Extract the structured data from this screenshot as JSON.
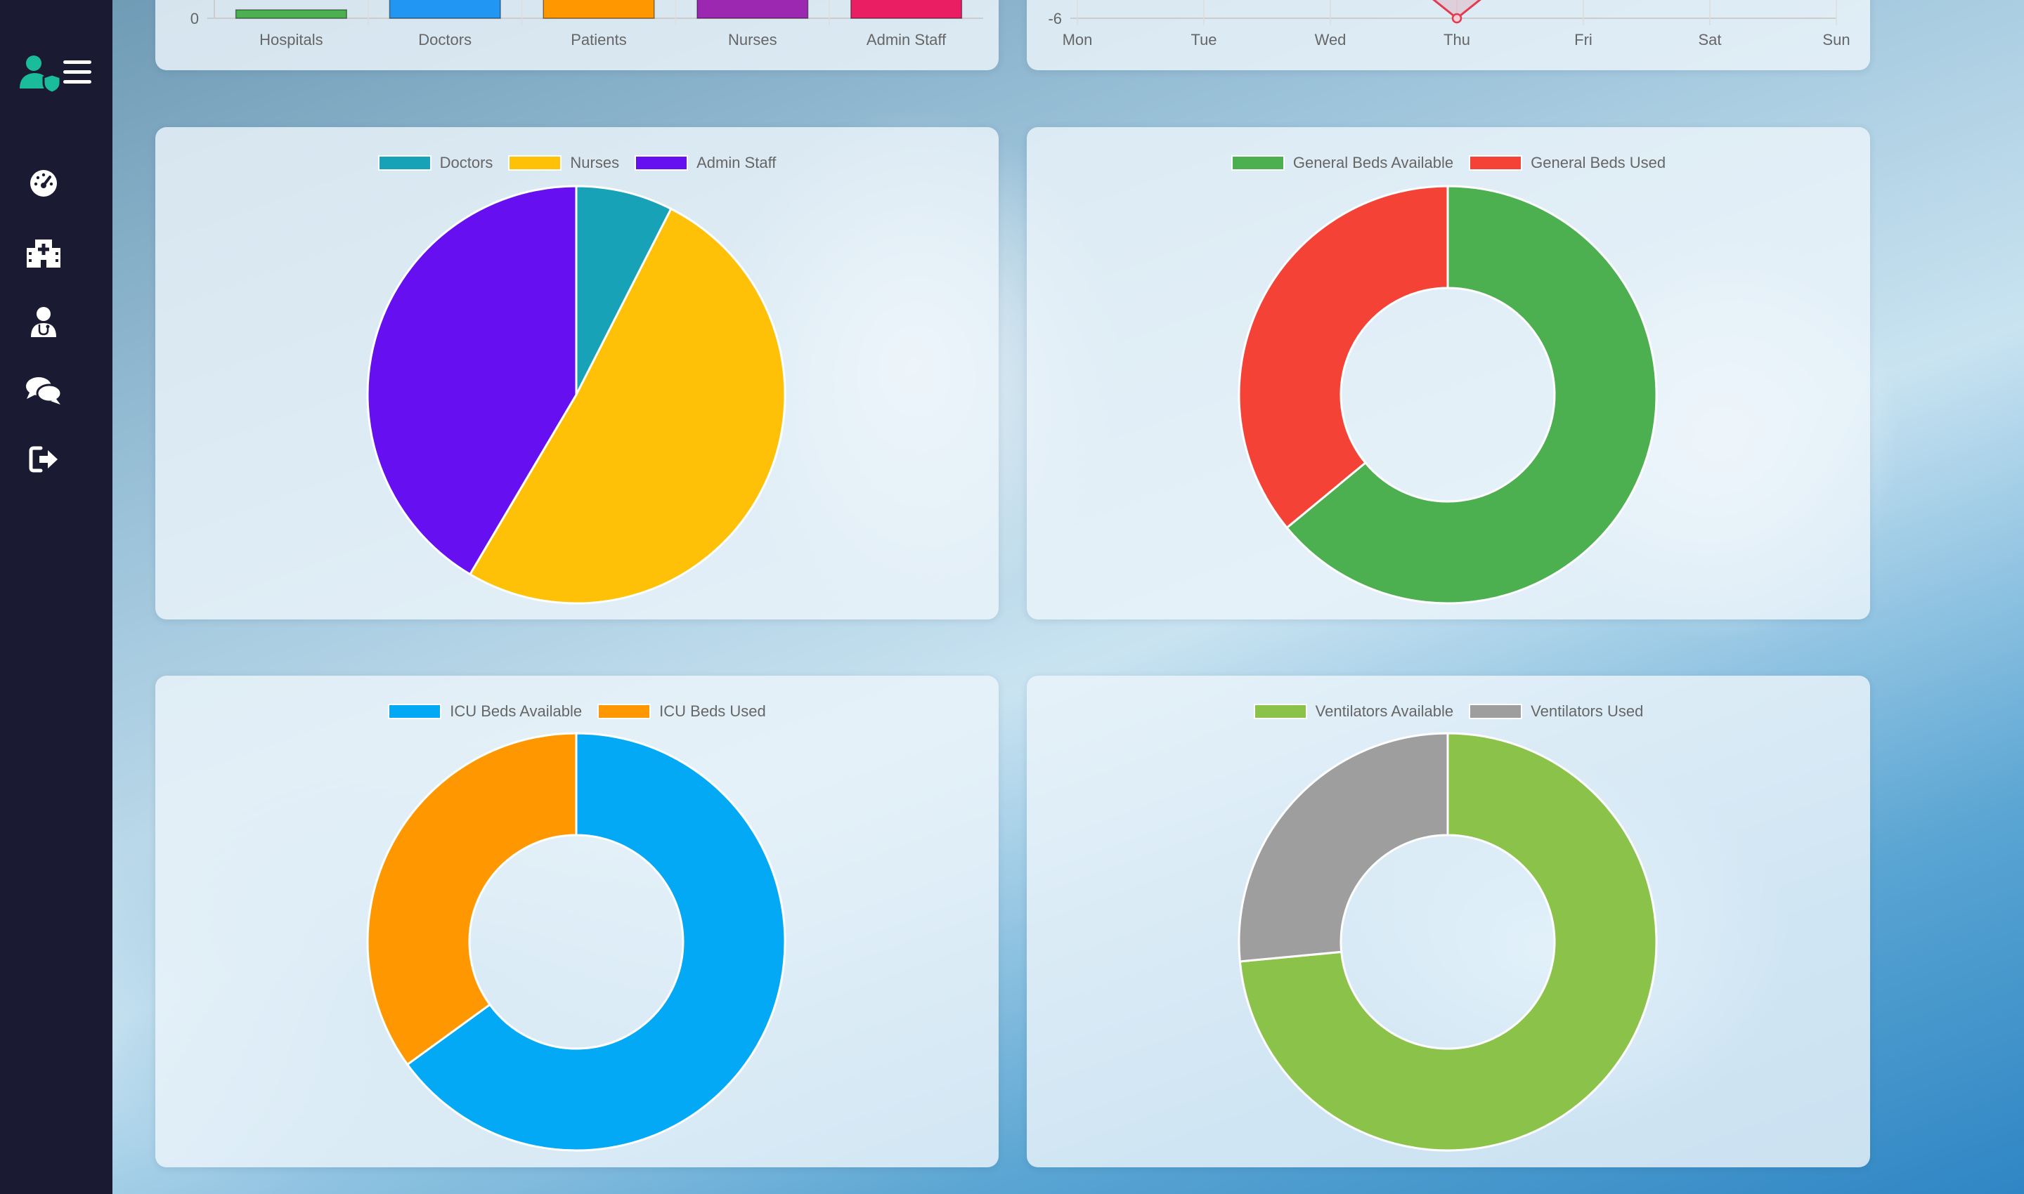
{
  "sidebar": {
    "items": [
      {
        "name": "dashboard",
        "icon": "speedometer-icon"
      },
      {
        "name": "hospitals",
        "icon": "hospital-icon"
      },
      {
        "name": "doctors",
        "icon": "user-doctor-icon"
      },
      {
        "name": "messages",
        "icon": "comments-icon"
      },
      {
        "name": "logout",
        "icon": "sign-out-icon"
      }
    ]
  },
  "colors": {
    "sidebar": "#1a1b33",
    "brand": "#1abc9c"
  },
  "chart_data": [
    {
      "type": "bar",
      "categories": [
        "Hospitals",
        "Doctors",
        "Patients",
        "Nurses",
        "Admin Staff"
      ],
      "y_tick_visible": "0",
      "colors": [
        "#4caf50",
        "#2196f3",
        "#ff9800",
        "#9c27b0",
        "#e91e63"
      ]
    },
    {
      "type": "line",
      "categories": [
        "Mon",
        "Tue",
        "Wed",
        "Thu",
        "Fri",
        "Sat",
        "Sun"
      ],
      "y_tick_visible": "-6",
      "colors": [
        "#e53950"
      ]
    },
    {
      "type": "pie",
      "labels": [
        "Doctors",
        "Nurses",
        "Admin Staff"
      ],
      "values": [
        7.5,
        51,
        41.5
      ],
      "colors": [
        "#17a2b8",
        "#ffc107",
        "#6610f2"
      ]
    },
    {
      "type": "doughnut",
      "labels": [
        "General Beds Available",
        "General Beds Used"
      ],
      "values": [
        64,
        36
      ],
      "colors": [
        "#4caf50",
        "#f44336"
      ]
    },
    {
      "type": "doughnut",
      "labels": [
        "ICU Beds Available",
        "ICU Beds Used"
      ],
      "values": [
        65,
        35
      ],
      "colors": [
        "#03a9f4",
        "#ff9800"
      ]
    },
    {
      "type": "doughnut",
      "labels": [
        "Ventilators Available",
        "Ventilators Used"
      ],
      "values": [
        73.5,
        26.5
      ],
      "colors": [
        "#8bc34a",
        "#9e9e9e"
      ]
    }
  ]
}
